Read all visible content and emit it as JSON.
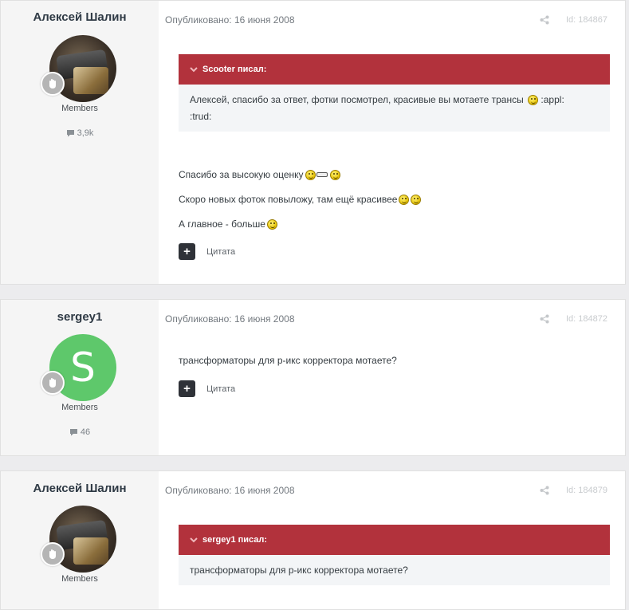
{
  "posts": [
    {
      "author": "Алексей Шалин",
      "group": "Members",
      "post_count": "3,9k",
      "published": "Опубликовано: 16 июня 2008",
      "post_id": "Id: 184867",
      "quote": {
        "header": "Scooter писал:",
        "text_line1": "Алексей, спасибо за ответ, фотки посмотрел, красивые вы мотаете трансы",
        "text_line1_tail": ":appl:",
        "text_line2": ":trud:"
      },
      "paragraphs": [
        "Спасибо за высокую оценку",
        "Скоро новых фоток повыложу, там ещё красивее",
        "А главное - больше"
      ],
      "quote_label": "Цитата"
    },
    {
      "author": "sergey1",
      "avatar_letter": "S",
      "group": "Members",
      "post_count": "46",
      "published": "Опубликовано: 16 июня 2008",
      "post_id": "Id: 184872",
      "paragraphs": [
        "трансформаторы для р-икс корректора мотаете?"
      ],
      "quote_label": "Цитата"
    },
    {
      "author": "Алексей Шалин",
      "group": "Members",
      "published": "Опубликовано: 16 июня 2008",
      "post_id": "Id: 184879",
      "quote": {
        "header": "sergey1 писал:",
        "text_line1": "трансформаторы для р-икс корректора мотаете?"
      }
    }
  ],
  "colors": {
    "quote_header": "#b2323c",
    "avatar_green": "#5ec86b",
    "sidebar_bg": "#f5f5f5"
  },
  "icons": [
    "rank-badge-icon",
    "comment-icon",
    "share-icon",
    "chevron-down-icon",
    "plus-icon",
    "smiley-icon"
  ]
}
